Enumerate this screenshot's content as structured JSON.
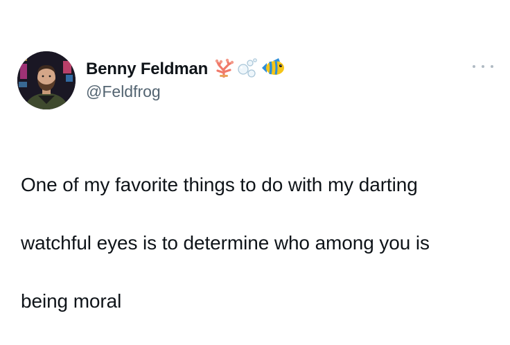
{
  "tweet": {
    "author": {
      "display_name": "Benny Feldman",
      "handle": "@Feldfrog",
      "name_emojis": [
        "coral-icon",
        "bubbles-icon",
        "tropical-fish-icon"
      ]
    },
    "more_menu_icon": "ellipsis-icon",
    "text_lines": [
      "One of my favorite things to do with my darting",
      "watchful eyes is to determine who among you is",
      "being moral"
    ]
  },
  "colors": {
    "text_primary": "#0f1419",
    "text_secondary": "#536471",
    "background": "#ffffff"
  }
}
